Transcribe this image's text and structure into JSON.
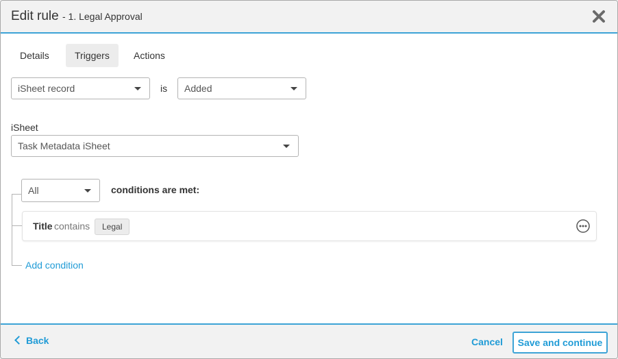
{
  "header": {
    "title": "Edit rule",
    "subtitle": " - 1. Legal Approval"
  },
  "tabs": [
    {
      "label": "Details",
      "active": false
    },
    {
      "label": "Triggers",
      "active": true
    },
    {
      "label": "Actions",
      "active": false
    }
  ],
  "trigger": {
    "source_value": "iSheet record",
    "is_label": "is",
    "event_value": "Added"
  },
  "isheet": {
    "label": "iSheet",
    "value": "Task Metadata iSheet"
  },
  "conditions": {
    "match_value": "All",
    "match_label": "conditions are met:",
    "items": [
      {
        "field": "Title",
        "operator": "contains",
        "value": "Legal"
      }
    ],
    "add_label": "Add condition"
  },
  "footer": {
    "back_label": "Back",
    "cancel_label": "Cancel",
    "save_label": "Save and continue"
  },
  "colors": {
    "accent": "#1f9bd6",
    "header_border": "#3ca3d6"
  },
  "icons": {
    "close": "close-icon",
    "more": "more-options-icon",
    "back": "chevron-left-icon",
    "dropdown": "caret-down-icon"
  }
}
